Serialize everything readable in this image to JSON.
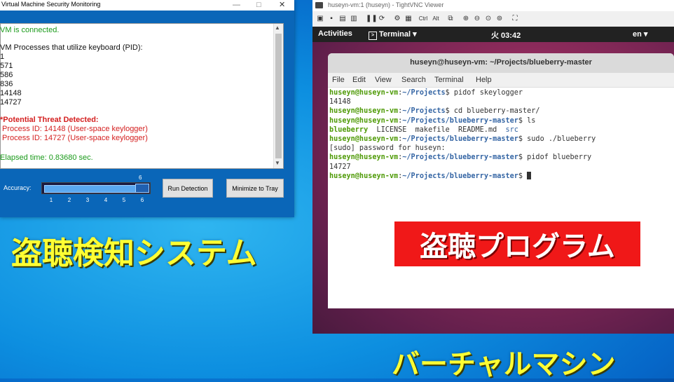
{
  "win_app": {
    "title": "Virtual Machine Security Monitoring",
    "controls": {
      "minimize": "—",
      "maximize": "□",
      "close": "✕"
    },
    "log": {
      "connected": "VM is connected.",
      "processes_header": "VM Processes that utilize keyboard (PID):",
      "pids": [
        "1",
        "571",
        "586",
        "836",
        "14148",
        "14727"
      ],
      "threat_header": "*Potential Threat Detected:",
      "threats": [
        "Process ID: 14148 (User-space keylogger)",
        "Process ID: 14727 (User-space keylogger)"
      ],
      "elapsed": "Elapsed time: 0.83680 sec."
    },
    "accuracy_label": "Accuracy:",
    "slider": {
      "value": 6,
      "min": 1,
      "max": 6,
      "ticks": [
        "1",
        "2",
        "3",
        "4",
        "5",
        "6"
      ],
      "value_label": "6"
    },
    "run_button": "Run Detection",
    "tray_button": "Minimize to Tray"
  },
  "vnc": {
    "title": "huseyn-vm:1 (huseyn) - TightVNC Viewer",
    "toolbar": {
      "ctrl": "Ctrl",
      "alt": "Alt"
    },
    "topbar": {
      "activities": "Activities",
      "terminal": "Terminal ▾",
      "clock": "火 03:42",
      "lang": "en ▾"
    },
    "terminal": {
      "title": "huseyn@huseyn-vm: ~/Projects/blueberry-master",
      "menu": [
        "File",
        "Edit",
        "View",
        "Search",
        "Terminal",
        "Help"
      ],
      "user": "huseyn@huseyn-vm",
      "path_projects": "~/Projects",
      "path_bb": "~/Projects/blueberry-master",
      "cmd1": " pidof skeylogger",
      "out1": "14148",
      "cmd2": " cd blueberry-master/",
      "cmd3": " ls",
      "ls_blueberry": "blueberry",
      "ls_mid": "  LICENSE  makefile  README.md  ",
      "ls_src": "src",
      "cmd4": " sudo ./blueberry",
      "out4": "[sudo] password for huseyn:",
      "cmd5": " pidof blueberry",
      "out5": "14727"
    }
  },
  "captions": {
    "left": "盗聴検知システム",
    "program": "盗聴プログラム",
    "right": "バーチャルマシン"
  },
  "colors": {
    "desktop": "#0d8fe0",
    "caption": "#ffff33",
    "program_bg": "#f01818",
    "ubuntu_bg": "#8a2a5a"
  }
}
